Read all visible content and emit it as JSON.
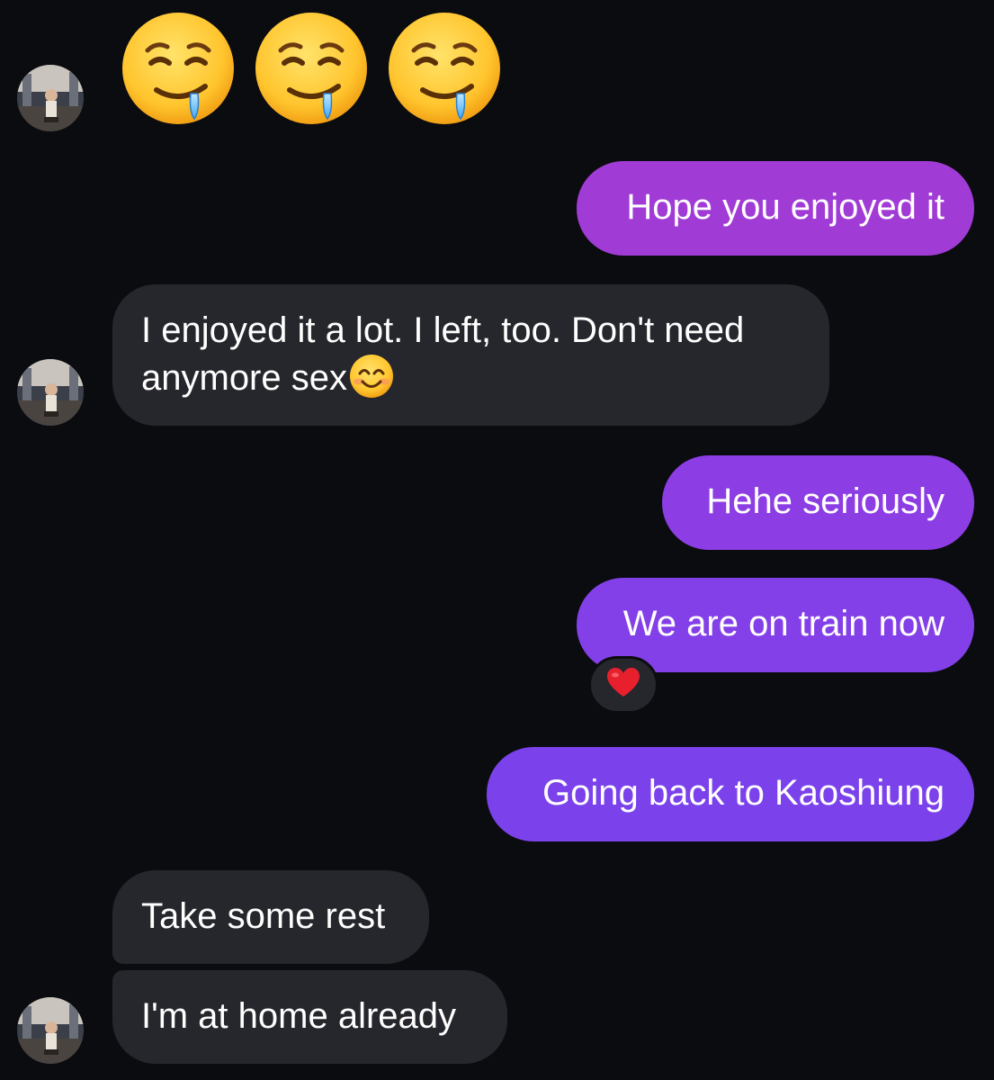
{
  "colors": {
    "background": "#0b0c10",
    "incoming_bubble": "#26272c",
    "outgoing_top": "#a13bd6",
    "outgoing_mid": "#8a3ee6",
    "outgoing_bottom": "#7b42eb"
  },
  "contact": {
    "avatar_icon": "contact-avatar"
  },
  "messages": [
    {
      "direction": "incoming",
      "type": "emoji",
      "emoji": [
        "drooling-face",
        "drooling-face",
        "drooling-face"
      ]
    },
    {
      "direction": "outgoing",
      "text": "Hope you enjoyed it"
    },
    {
      "direction": "incoming",
      "text_line1": "I enjoyed it a lot. I left, too. Don't need",
      "text_line2": "anymore sex",
      "trailing_emoji": "smiling-face-icon"
    },
    {
      "direction": "outgoing",
      "text": "Hehe seriously"
    },
    {
      "direction": "outgoing",
      "text": "We are on train now",
      "reaction": "red-heart-icon"
    },
    {
      "direction": "outgoing",
      "text": "Going back to Kaoshiung"
    },
    {
      "direction": "incoming",
      "text": "Take some rest"
    },
    {
      "direction": "incoming",
      "text": "I'm at home already"
    }
  ]
}
